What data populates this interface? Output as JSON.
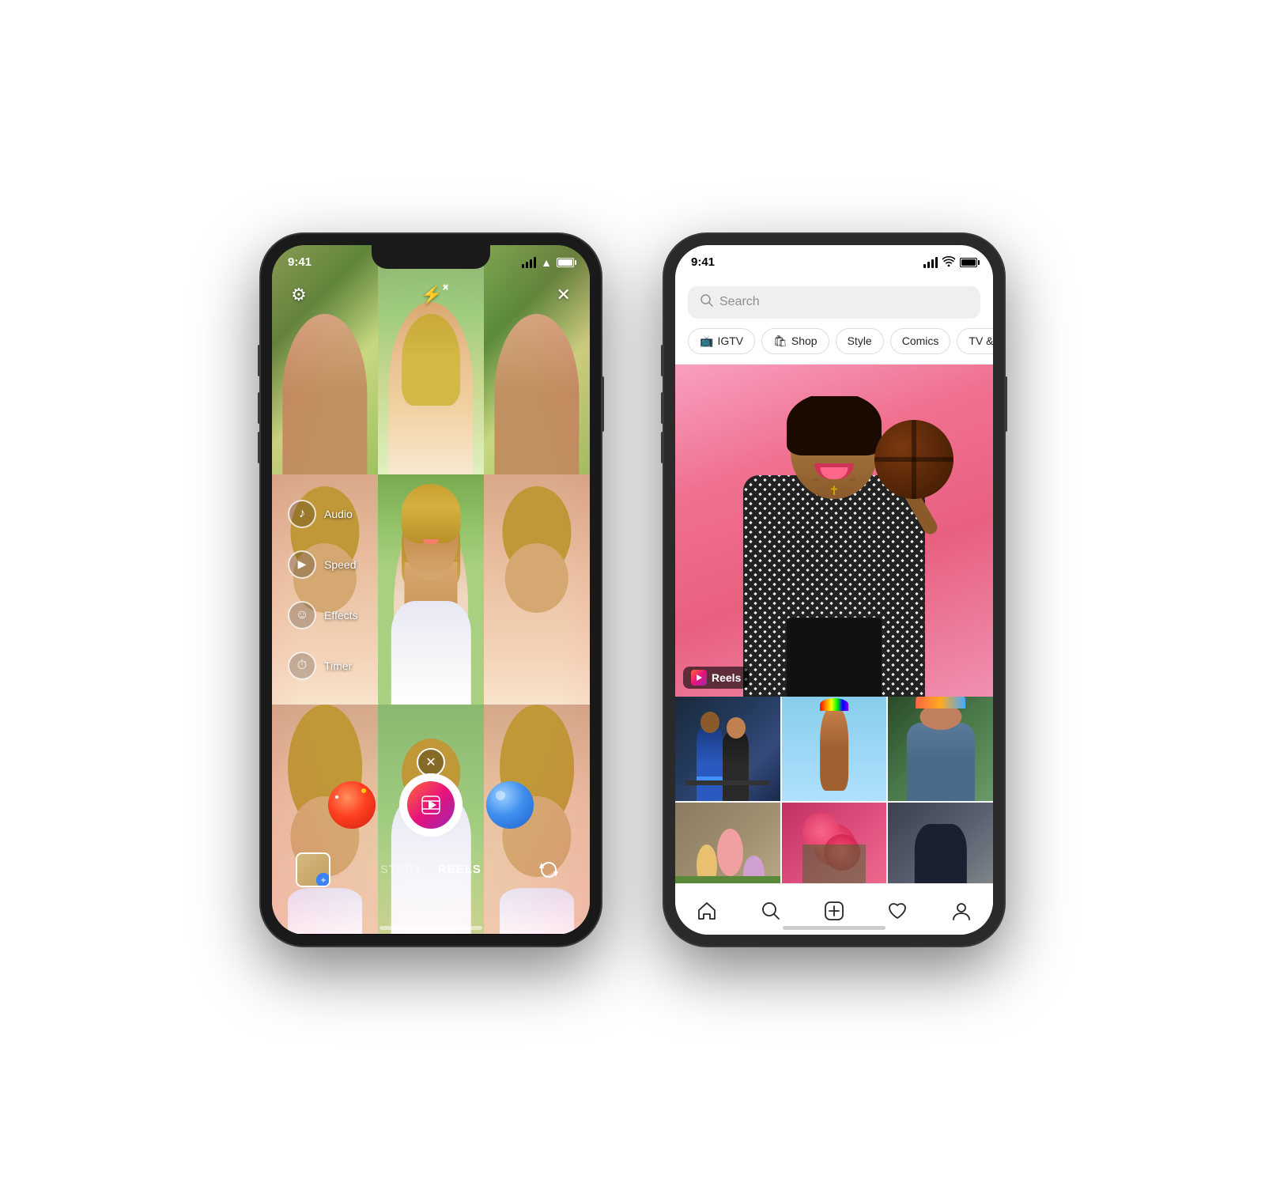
{
  "phones": {
    "left": {
      "time": "9:41",
      "type": "camera",
      "mode": "REELS",
      "modes": [
        "STORY",
        "REELS"
      ],
      "side_menu": [
        {
          "icon": "♪",
          "label": "Audio"
        },
        {
          "icon": "▶",
          "label": "Speed"
        },
        {
          "icon": "☺",
          "label": "Effects"
        },
        {
          "icon": "⏱",
          "label": "Timer"
        }
      ],
      "top_icons": {
        "settings": "⚙",
        "flash": "⚡",
        "close": "✕"
      },
      "filter_close": "✕",
      "flip_camera": "↻"
    },
    "right": {
      "time": "9:41",
      "type": "explore",
      "search": {
        "placeholder": "Search",
        "icon": "🔍"
      },
      "filter_tabs": [
        {
          "label": "IGTV",
          "icon": "📺"
        },
        {
          "label": "Shop",
          "icon": "🛍"
        },
        {
          "label": "Style",
          "icon": ""
        },
        {
          "label": "Comics",
          "icon": ""
        },
        {
          "label": "TV & Movies",
          "icon": ""
        }
      ],
      "featured": {
        "badge": "Reels"
      },
      "nav_items": [
        {
          "icon": "home",
          "label": "Home"
        },
        {
          "icon": "search",
          "label": "Search"
        },
        {
          "icon": "plus",
          "label": "Create"
        },
        {
          "icon": "heart",
          "label": "Activity"
        },
        {
          "icon": "person",
          "label": "Profile"
        }
      ]
    }
  }
}
